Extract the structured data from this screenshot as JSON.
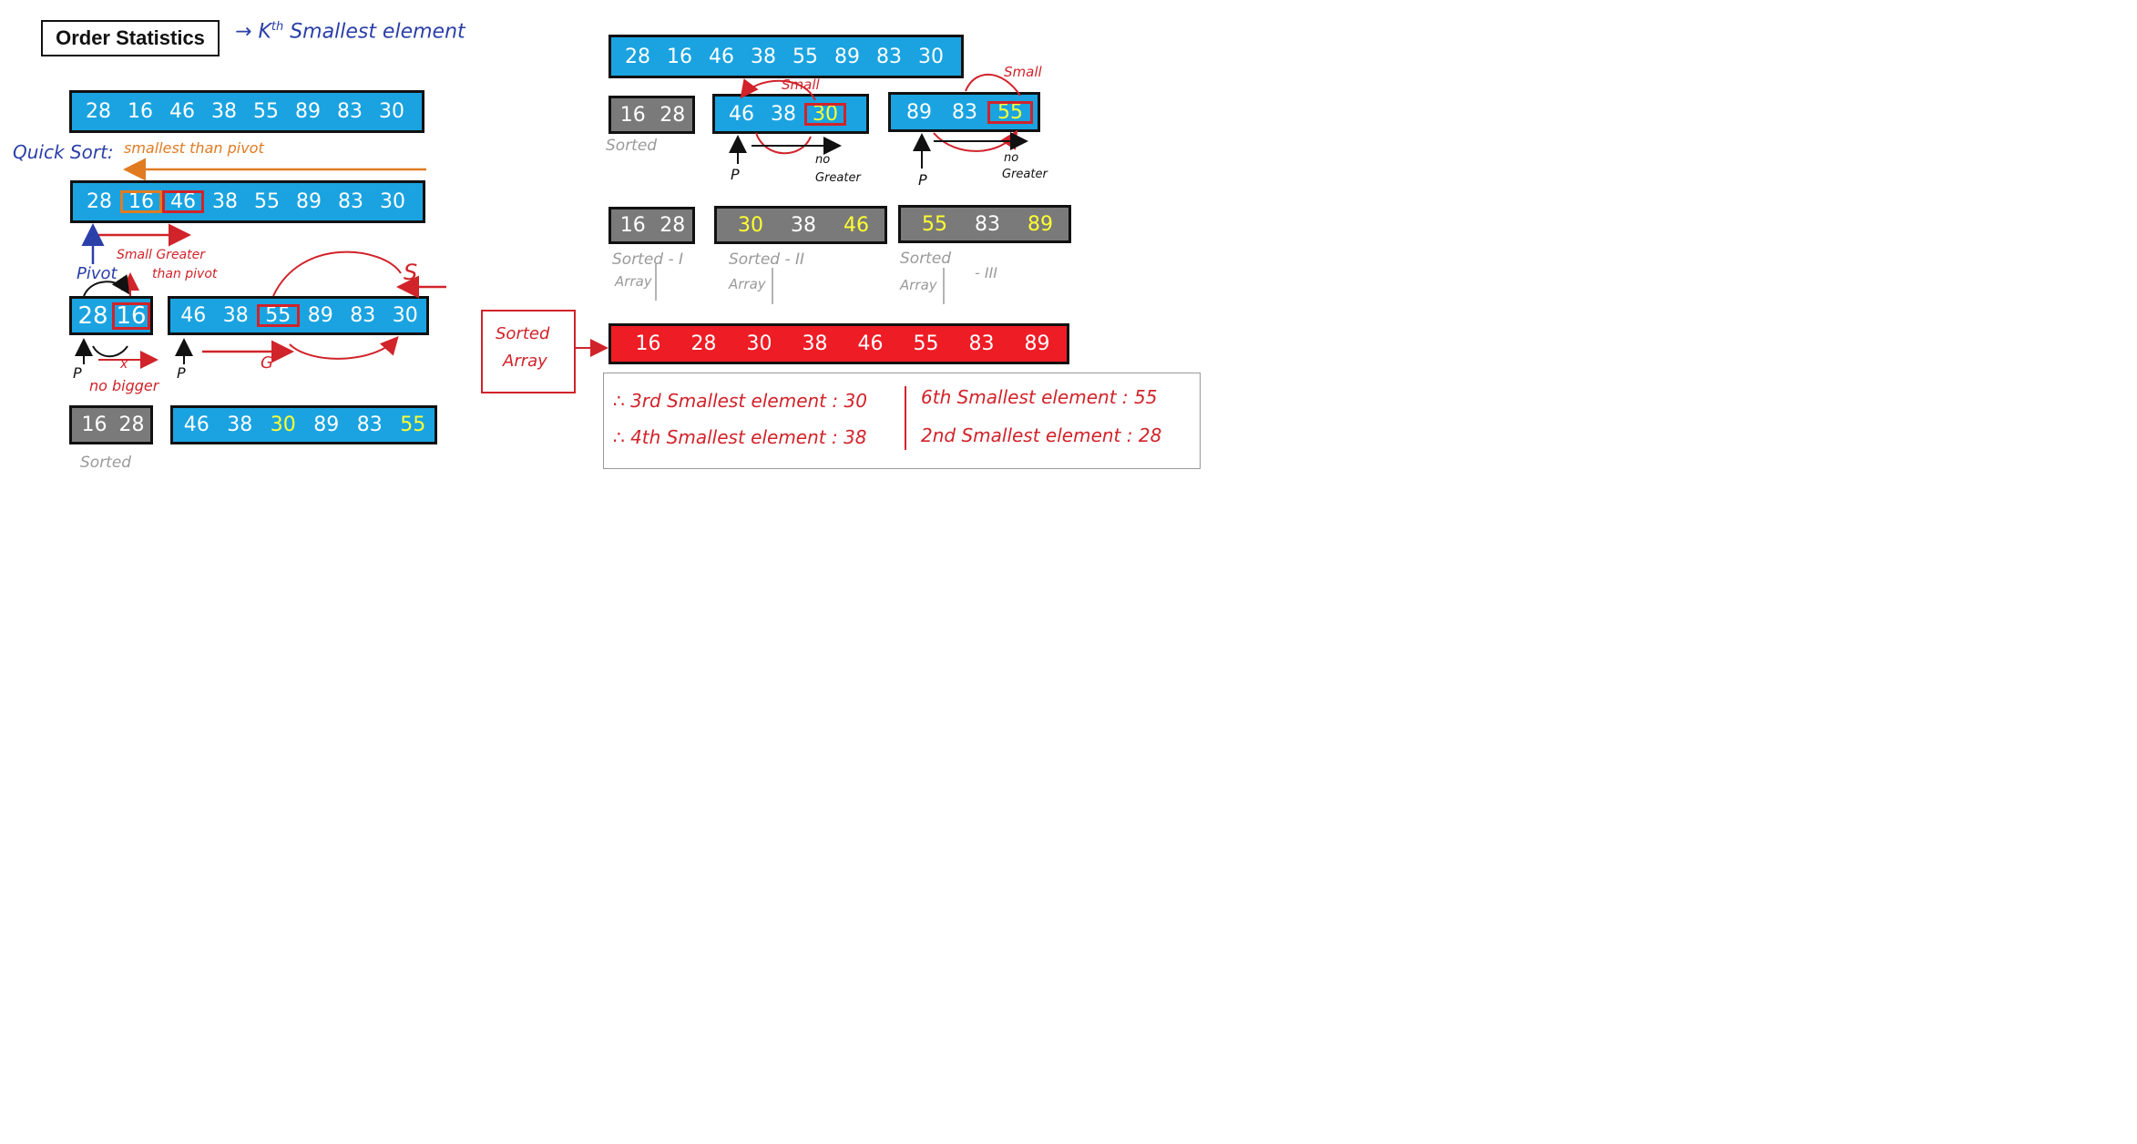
{
  "title": "Order Statistics",
  "subtitle": "K",
  "subtitle_sup": "th",
  "subtitle_rest": "Smallest element",
  "left": {
    "row1": [
      "28",
      "16",
      "46",
      "38",
      "55",
      "89",
      "83",
      "30"
    ],
    "quick_sort_label": "Quick Sort:",
    "smallest_than_pivot": "smallest than pivot",
    "row2": [
      "28",
      "16",
      "46",
      "38",
      "55",
      "89",
      "83",
      "30"
    ],
    "small_greater_label": "Small Greater",
    "than_pivot_label": "than pivot",
    "pivot_label": "Pivot",
    "s_label": "S",
    "g_label": "G",
    "row3a": [
      "28",
      "16"
    ],
    "row3b": [
      "46",
      "38",
      "55",
      "89",
      "83",
      "30"
    ],
    "p_label": "P",
    "x_label": "x",
    "no_bigger_label": "no bigger",
    "row4a": [
      "16",
      "28"
    ],
    "row4b": [
      "46",
      "38",
      "30",
      "89",
      "83",
      "55"
    ],
    "sorted_label": "Sorted"
  },
  "right": {
    "row1": [
      "28",
      "16",
      "46",
      "38",
      "55",
      "89",
      "83",
      "30"
    ],
    "small_label_1": "Small",
    "small_label_2": "Small",
    "row2a": [
      "16",
      "28"
    ],
    "row2b": [
      "46",
      "38",
      "30"
    ],
    "row2c": [
      "89",
      "83",
      "55"
    ],
    "sorted_label": "Sorted",
    "p_label": "P",
    "no_greater_label_no": "no",
    "no_greater_label": "Greater",
    "row3a": [
      "16",
      "28"
    ],
    "row3b": [
      "30",
      "38",
      "46"
    ],
    "row3c": [
      "55",
      "83",
      "89"
    ],
    "sorted_array_1": "Sorted - I",
    "sorted_array_2": "Sorted - II",
    "sorted_array_3": "Sorted",
    "array_word": "Array",
    "roman_3": "- III",
    "sorted_array_box": "Sorted",
    "sorted_array_box_2": "Array",
    "final_row": [
      "16",
      "28",
      "30",
      "38",
      "46",
      "55",
      "83",
      "89"
    ],
    "results": {
      "r1": "∴ 3rd Smallest element : 30",
      "r2": "∴ 4th Smallest element : 38",
      "r3": "6th Smallest element : 55",
      "r4": "2nd Smallest element : 28"
    }
  },
  "colors": {
    "bar_blue": "#1aa3e0",
    "bar_gray": "#7a7a7a",
    "bar_red": "#ee1c25",
    "highlight_yellow": "#ffff33",
    "ink_red": "#d1232a",
    "ink_blue": "#2b3fa8",
    "ink_orange": "#e07b22"
  }
}
